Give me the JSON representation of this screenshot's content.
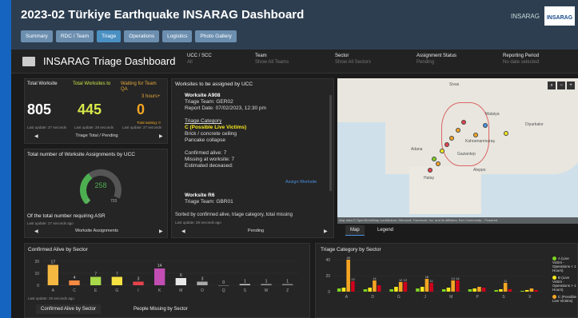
{
  "app": {
    "title": "2023-02 Türkiye Earthquake INSARAG Dashboard",
    "brand": "INSARAG",
    "logo_text": "INSARAG"
  },
  "nav": {
    "tabs": [
      {
        "label": "Summary"
      },
      {
        "label": "RDC / Team"
      },
      {
        "label": "Triage",
        "active": true
      },
      {
        "label": "Operations"
      },
      {
        "label": "Logistics"
      },
      {
        "label": "Photo Gallery"
      }
    ]
  },
  "header": {
    "title": "INSARAG Triage Dashboard",
    "filters": [
      {
        "label": "UCC / SCC",
        "value": "All"
      },
      {
        "label": "Team",
        "value": "Show All Teams"
      },
      {
        "label": "Sector",
        "value": "Show All Sectors"
      },
      {
        "label": "Assignment Status",
        "value": "Pending"
      },
      {
        "label": "Reporting Period",
        "value": "No date selected"
      }
    ]
  },
  "stats": {
    "total_worksite": {
      "label": "Total Worksite",
      "value": "805"
    },
    "total_to": {
      "label": "Total Worksites to",
      "value": "445"
    },
    "waiting": {
      "label": "Waiting for Team QA",
      "extra": "3 hours+",
      "value": "0",
      "note": "Total waiting: 0"
    },
    "last_update_1": "Last update: 27 seconds",
    "last_update_2": "Last update: 28 seconds",
    "last_update_3": "Last update: 27 seconds",
    "footer": "Triage Total / Pending"
  },
  "gauge": {
    "title": "Total number of Worksite Assignments by UCC",
    "value": "258",
    "min": "0",
    "max": "703",
    "fraction": 0.367,
    "caption": "Of the total number requiring ASR",
    "last_update": "Last update: 27 seconds ago",
    "footer": "Worksite Assignments"
  },
  "worksites": {
    "title": "Worksites to be assigned by UCC",
    "w1": {
      "name": "Worksite A908",
      "team": "Triage Team: GER02",
      "date": "Report Date: 07/02/2023, 12:30 pm",
      "cat_label": "Triage Category",
      "cat_value": "C (Possible Live Victims)",
      "desc1": "Brick / concrete ceiling",
      "desc2": "Pancake collapse",
      "alive": "Confirmed alive: 7",
      "missing": "Missing at worksite: 7",
      "deceased": "Estimated deceased:",
      "assign": "Assign Worksite"
    },
    "w2": {
      "name": "Worksite R6",
      "team": "Triage Team: GBR01"
    },
    "sort_note": "Sorted by confirmed alive, triage category, total missing",
    "last_update": "Last update: 28 seconds ago",
    "footer": "Pending"
  },
  "map": {
    "labels": [
      "Sivas",
      "Malatya",
      "Diyarbakır",
      "Kahramanmaraş",
      "Gaziantep",
      "Adana",
      "Aleppo",
      "Hatay"
    ],
    "attribution": "Map data © OpenStreetMap contributors, Microsoft, Facebook, Inc. and its affiliates, Esri Community...",
    "powered": "Powered",
    "tabs": [
      "Map",
      "Legend"
    ]
  },
  "confirmed_chart": {
    "title": "Confirmed Alive by Sector",
    "last_update": "Last update: 28 seconds ago",
    "tabs": [
      "Confirmed Alive by Sector",
      "People Missing by Sector"
    ],
    "chart_data": {
      "type": "bar",
      "title": "Confirmed Alive by Sector",
      "categories": [
        "A",
        "C",
        "E",
        "G",
        "I",
        "K",
        "M",
        "O",
        "Q",
        "S",
        "W",
        "Z"
      ],
      "values": [
        17,
        4,
        7,
        7,
        3,
        14,
        6,
        3,
        0,
        1,
        1,
        1
      ],
      "ylim": [
        0,
        20
      ],
      "yticks": [
        0,
        10,
        20
      ],
      "colors": [
        "#f5b942",
        "#f58a42",
        "#a8d94a",
        "#f5e142",
        "#e8424d",
        "#c24db3",
        "#e8e8e8",
        "#aaaaaa",
        "#999999",
        "#cccccc",
        "#999999",
        "#888888"
      ]
    }
  },
  "triage_chart": {
    "title": "Triage Category by Sector",
    "chart_data": {
      "type": "bar",
      "title": "Triage Category by Sector",
      "categories": [
        "A",
        "D",
        "G",
        "J",
        "M",
        "P",
        "S",
        "X"
      ],
      "series": [
        {
          "name": "A (Live Victim - Operations < 1 Hours)",
          "color": "#7ed321",
          "values": [
            4,
            3,
            3,
            4,
            3,
            3,
            2,
            1
          ]
        },
        {
          "name": "B (Live Victim - Operations > 1 Hours)",
          "color": "#f8e71c",
          "values": [
            5,
            5,
            6,
            6,
            5,
            4,
            3,
            2
          ]
        },
        {
          "name": "C (Possible Live Victims)",
          "color": "#f5a623",
          "values": [
            45,
            14,
            12,
            16,
            14,
            6,
            11,
            4
          ]
        },
        {
          "name": "Other",
          "color": "#d0021b",
          "values": [
            13,
            8,
            12,
            11,
            14,
            5,
            3,
            2
          ]
        }
      ],
      "ylim": [
        0,
        40
      ],
      "yticks": [
        0,
        20,
        40
      ]
    },
    "legend": [
      {
        "label": "A (Live Victim - Operations < 1 Hours)",
        "color": "#7ed321"
      },
      {
        "label": "B (Live Victim - Operations > 1 Hours)",
        "color": "#f8e71c"
      },
      {
        "label": "C (Possible Live Victims)",
        "color": "#f5a623"
      }
    ]
  }
}
